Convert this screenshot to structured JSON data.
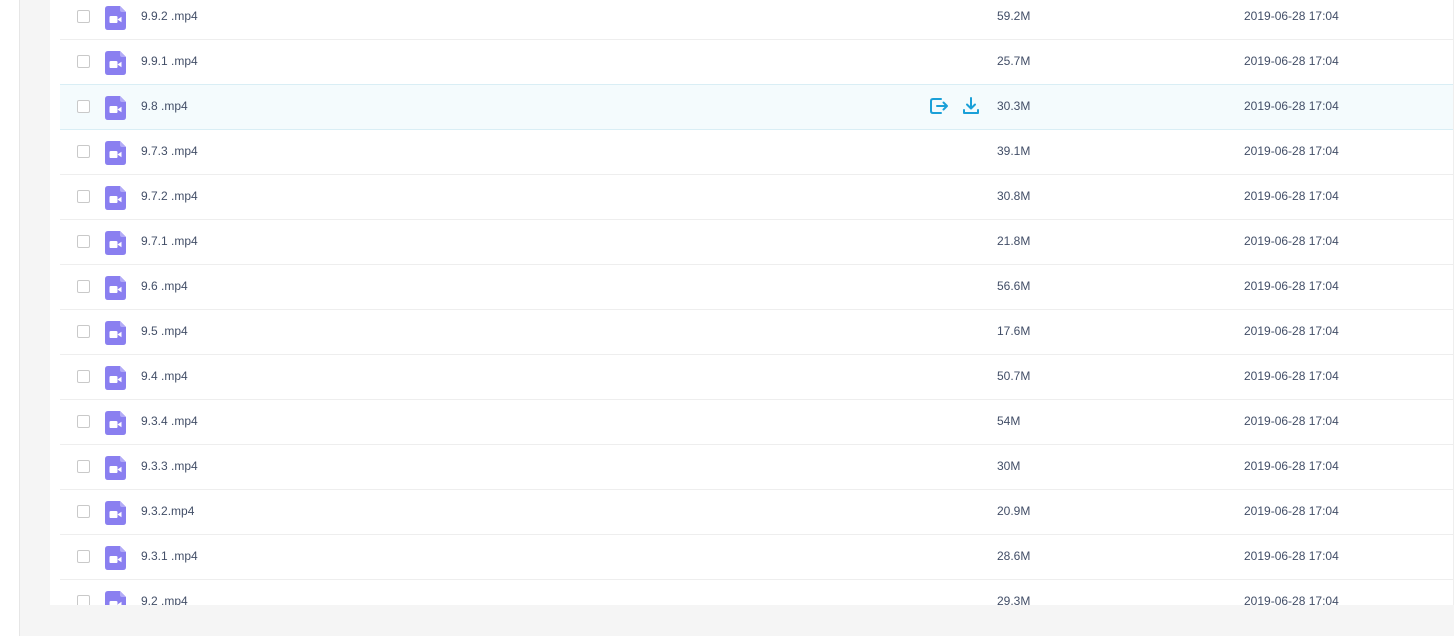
{
  "accent_color": "#1aa0d8",
  "file_icon_color": "#8a7ff0",
  "files": [
    {
      "name": "9.9.2 .mp4",
      "size": "59.2M",
      "date": "2019-06-28 17:04",
      "icon": "video-file-icon"
    },
    {
      "name": "9.9.1 .mp4",
      "size": "25.7M",
      "date": "2019-06-28 17:04",
      "icon": "video-file-icon"
    },
    {
      "name": "9.8 .mp4",
      "size": "30.3M",
      "date": "2019-06-28 17:04",
      "icon": "video-file-icon",
      "hovered": true,
      "actions": [
        "share-icon",
        "download-icon"
      ]
    },
    {
      "name": "9.7.3 .mp4",
      "size": "39.1M",
      "date": "2019-06-28 17:04",
      "icon": "video-file-icon"
    },
    {
      "name": "9.7.2 .mp4",
      "size": "30.8M",
      "date": "2019-06-28 17:04",
      "icon": "video-file-icon"
    },
    {
      "name": "9.7.1 .mp4",
      "size": "21.8M",
      "date": "2019-06-28 17:04",
      "icon": "video-file-icon"
    },
    {
      "name": "9.6 .mp4",
      "size": "56.6M",
      "date": "2019-06-28 17:04",
      "icon": "video-file-icon"
    },
    {
      "name": "9.5 .mp4",
      "size": "17.6M",
      "date": "2019-06-28 17:04",
      "icon": "video-file-icon"
    },
    {
      "name": "9.4 .mp4",
      "size": "50.7M",
      "date": "2019-06-28 17:04",
      "icon": "video-file-icon"
    },
    {
      "name": "9.3.4 .mp4",
      "size": "54M",
      "date": "2019-06-28 17:04",
      "icon": "video-file-icon"
    },
    {
      "name": "9.3.3 .mp4",
      "size": "30M",
      "date": "2019-06-28 17:04",
      "icon": "video-file-icon"
    },
    {
      "name": "9.3.2.mp4",
      "size": "20.9M",
      "date": "2019-06-28 17:04",
      "icon": "video-file-icon"
    },
    {
      "name": "9.3.1 .mp4",
      "size": "28.6M",
      "date": "2019-06-28 17:04",
      "icon": "video-file-icon"
    },
    {
      "name": "9.2 .mp4",
      "size": "29.3M",
      "date": "2019-06-28 17:04",
      "icon": "video-file-icon"
    }
  ]
}
